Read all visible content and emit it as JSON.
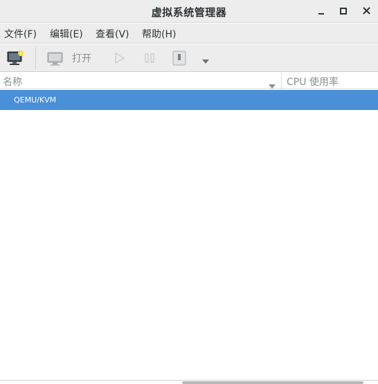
{
  "window": {
    "title": "虚拟系统管理器",
    "controls": [
      "minimize-icon",
      "maximize-icon",
      "close-icon"
    ]
  },
  "menubar": {
    "items": [
      {
        "label": "文件(F)"
      },
      {
        "label": "编辑(E)"
      },
      {
        "label": "查看(V)"
      },
      {
        "label": "帮助(H)"
      }
    ]
  },
  "toolbar": {
    "new_vm_icon": "new-vm-icon",
    "open_icon": "monitor-icon",
    "open_label": "打开",
    "run_icon": "play-icon",
    "pause_icon": "pause-icon",
    "shutdown_icon": "power-icon",
    "shutdown_menu_icon": "chevron-down-icon"
  },
  "table": {
    "columns": [
      {
        "label": "名称",
        "sort_icon": "chevron-down-icon"
      },
      {
        "label": "CPU 使用率"
      }
    ],
    "rows": [
      {
        "name": "QEMU/KVM",
        "selected": true
      }
    ]
  },
  "colors": {
    "chrome_bg": "#ededed",
    "selection": "#4a90d9",
    "muted_text": "#8a8e8f"
  }
}
